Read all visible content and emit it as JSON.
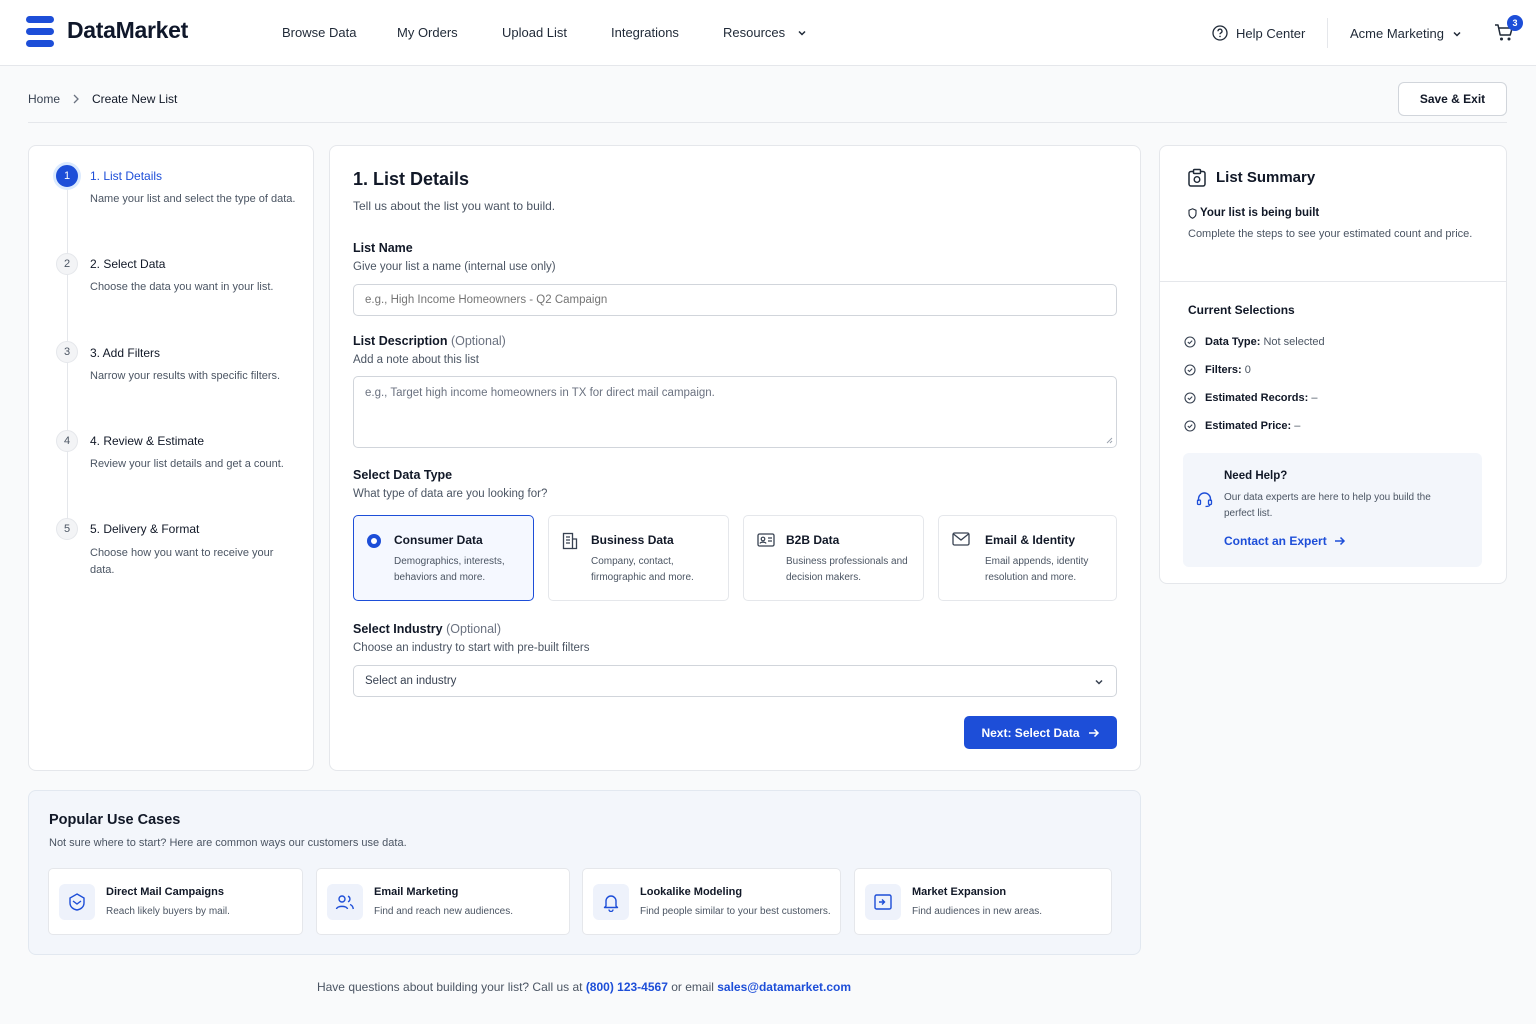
{
  "brand": {
    "name": "DataMarket",
    "color": "#1d4ed8"
  },
  "nav": {
    "browse": "Browse Data",
    "orders": "My Orders",
    "upload": "Upload List",
    "integrations": "Integrations",
    "resources": "Resources",
    "help": "Help Center",
    "account": "Acme Marketing",
    "cart_count": "3"
  },
  "breadcrumb": {
    "home": "Home",
    "current": "Create New List"
  },
  "actions": {
    "save_exit": "Save & Exit"
  },
  "steps": [
    {
      "num": "1",
      "label": "1. List Details",
      "desc": "Name your list and select the type of data.",
      "state": "active"
    },
    {
      "num": "2",
      "label": "2. Select Data",
      "desc": "Choose the data you want in your list.",
      "state": "pending"
    },
    {
      "num": "3",
      "label": "3. Add Filters",
      "desc": "Narrow your results with specific filters.",
      "state": "pending"
    },
    {
      "num": "4",
      "label": "4. Review & Estimate",
      "desc": "Review your list details and get a count.",
      "state": "pending"
    },
    {
      "num": "5",
      "label": "5. Delivery & Format",
      "desc": "Choose how you want to receive your data.",
      "state": "pending"
    }
  ],
  "form": {
    "title": "1. List Details",
    "subtitle": "Tell us about the list you want to build.",
    "name_label": "List Name",
    "name_help": "Give your list a name (internal use only)",
    "name_value": "",
    "name_placeholder": "e.g., High Income Homeowners - Q2 Campaign",
    "desc_label": "List Description",
    "desc_optional": "(Optional)",
    "desc_help": "Add a note about this list",
    "desc_value": "",
    "desc_placeholder": "e.g., Target high income homeowners in TX for direct mail campaign.",
    "type_label": "Select Data Type",
    "type_help": "What type of data are you looking for?",
    "types": [
      {
        "title": "Consumer Data",
        "desc": "Demographics, interests, behaviors and more.",
        "icon": "radio-selected-icon",
        "selected": true
      },
      {
        "title": "Business Data",
        "desc": "Company, contact, firmographic and more.",
        "icon": "building-icon",
        "selected": false
      },
      {
        "title": "B2B Data",
        "desc": "Business professionals and decision makers.",
        "icon": "id-card-icon",
        "selected": false
      },
      {
        "title": "Email & Identity",
        "desc": "Email appends, identity resolution and more.",
        "icon": "mail-icon",
        "selected": false
      }
    ],
    "industry_label": "Select Industry",
    "industry_optional": "(Optional)",
    "industry_help": "Choose an industry to start with pre-built filters",
    "industry_value": "Select an industry",
    "next": "Next: Select Data"
  },
  "summary": {
    "title": "List Summary",
    "status": "Your list is being built",
    "status_desc": "Complete the steps to see your estimated count and price.",
    "current_title": "Current Selections",
    "rows": [
      {
        "label": "Data Type:",
        "value": "Not selected"
      },
      {
        "label": "Filters:",
        "value": "0"
      },
      {
        "label": "Estimated Records:",
        "value": "–"
      },
      {
        "label": "Estimated Price:",
        "value": "–"
      }
    ],
    "help_title": "Need Help?",
    "help_desc": "Our data experts are here to help you build the perfect list.",
    "help_link": "Contact an Expert"
  },
  "use_cases": {
    "title": "Popular Use Cases",
    "subtitle": "Not sure where to start? Here are common ways our customers use data.",
    "items": [
      {
        "title": "Direct Mail Campaigns",
        "desc": "Reach likely buyers by mail.",
        "icon": "mail-check-icon"
      },
      {
        "title": "Email Marketing",
        "desc": "Find and reach new audiences.",
        "icon": "users-icon"
      },
      {
        "title": "Lookalike Modeling",
        "desc": "Find people similar to your best customers.",
        "icon": "bell-icon"
      },
      {
        "title": "Market Expansion",
        "desc": "Find audiences in new areas.",
        "icon": "map-expand-icon"
      }
    ]
  },
  "footer": {
    "text": "Have questions about building your list? Call us at",
    "phone": "(800) 123-4567",
    "mid": "or email",
    "email": "sales@datamarket.com"
  }
}
